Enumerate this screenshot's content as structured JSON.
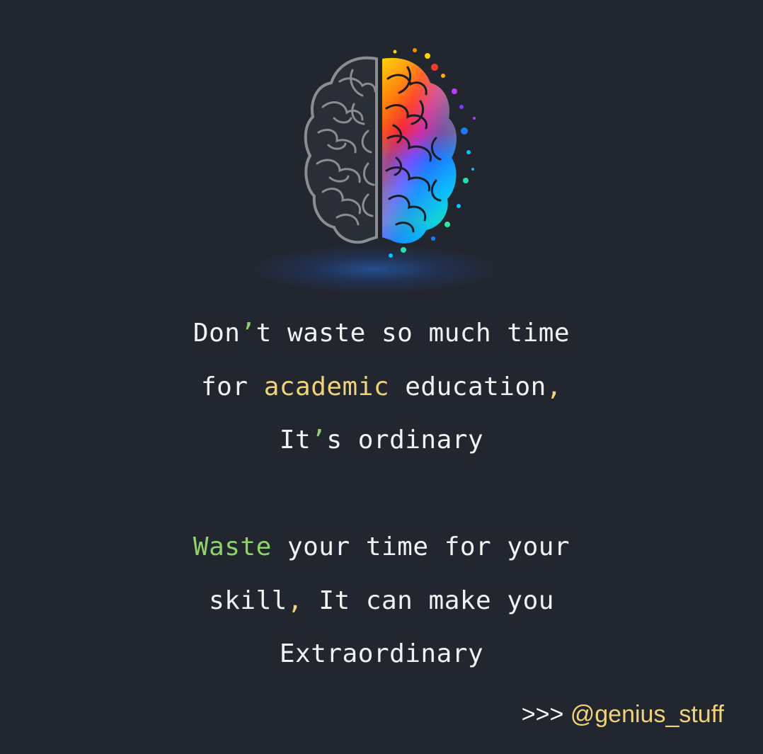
{
  "colors": {
    "background": "#22262f",
    "text": "#f2f2f2",
    "accent_yellow": "#f0d27a",
    "accent_green": "#8fd26a",
    "glow": "#2a6ed8"
  },
  "illustration": {
    "icon": "brain-icon"
  },
  "quote": {
    "line1": {
      "a": "Don",
      "b": "’",
      "c": "t waste so much time"
    },
    "line2": {
      "a": "for ",
      "b": "academic",
      "c": " education",
      "d": ","
    },
    "line3": {
      "a": "It",
      "b": "’",
      "c": "s ordinary"
    },
    "line4": {
      "a": "Waste",
      "b": " your time for your"
    },
    "line5": {
      "a": "skill",
      "b": ",",
      "c": " It can make you"
    },
    "line6": {
      "a": "Extraordinary"
    }
  },
  "footer": {
    "prefix": ">>> ",
    "handle": "@genius_stuff"
  }
}
